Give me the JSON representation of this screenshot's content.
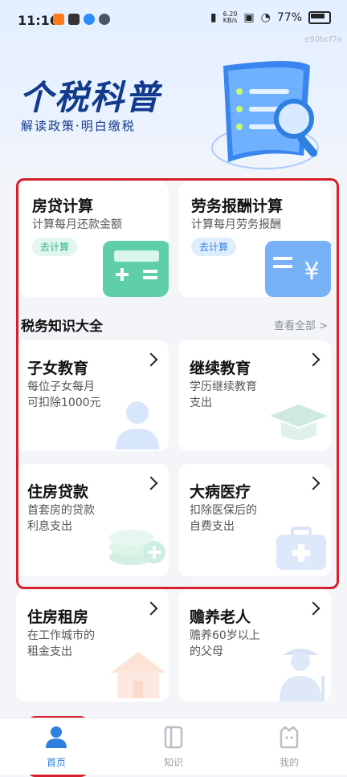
{
  "status": {
    "time": "11:16",
    "speed": "6.20\nKB/s",
    "battery": "77%"
  },
  "device_id": "e90bcf7e",
  "hero": {
    "title": "个税科普",
    "subtitle": "解读政策·明白缴税"
  },
  "calculators": [
    {
      "title": "房贷计算",
      "desc": "计算每月还款金额",
      "action": "去计算",
      "accent": "#2fb38a"
    },
    {
      "title": "劳务报酬计算",
      "desc": "计算每月劳务报酬",
      "action": "去计算",
      "accent": "#2f7fe0"
    }
  ],
  "knowledge_section": {
    "title": "税务知识大全",
    "view_all": "查看全部 >"
  },
  "knowledge_items": [
    {
      "title": "子女教育",
      "desc_line1": "每位子女每月",
      "desc_line2": "可扣除1000元",
      "icon": "person-icon"
    },
    {
      "title": "继续教育",
      "desc_line1": "学历继续教育",
      "desc_line2": "支出",
      "icon": "graduation-cap-icon"
    },
    {
      "title": "住房贷款",
      "desc_line1": "首套房的贷款",
      "desc_line2": "利息支出",
      "icon": "coins-icon"
    },
    {
      "title": "大病医疗",
      "desc_line1": "扣除医保后的",
      "desc_line2": "自费支出",
      "icon": "medical-kit-icon"
    },
    {
      "title": "住房租房",
      "desc_line1": "在工作城市的",
      "desc_line2": "租金支出",
      "icon": "house-icon"
    },
    {
      "title": "赡养老人",
      "desc_line1": "赡养60岁以上",
      "desc_line2": "的父母",
      "icon": "elder-icon"
    }
  ],
  "nav": [
    {
      "label": "首页",
      "icon": "home-person-icon",
      "active": true
    },
    {
      "label": "知识",
      "icon": "book-icon",
      "active": false
    },
    {
      "label": "我的",
      "icon": "profile-face-icon",
      "active": false
    }
  ],
  "colors": {
    "accent_blue": "#2f7fe0",
    "accent_green": "#2fb38a",
    "highlight_red": "#d8202c",
    "hero_text": "#123a8d"
  }
}
